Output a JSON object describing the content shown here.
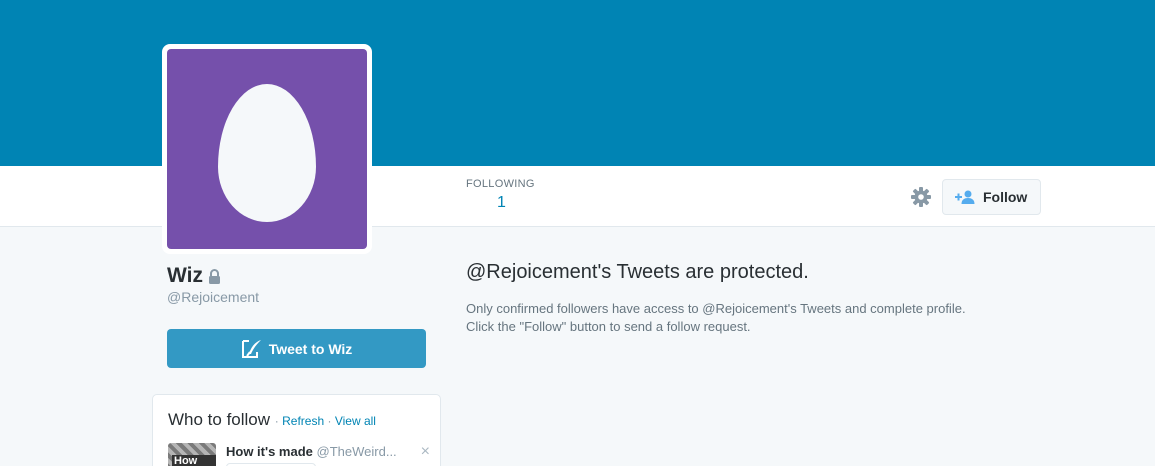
{
  "profile": {
    "name": "Wiz",
    "handle": "@Rejoicement"
  },
  "stats": {
    "following_label": "FOLLOWING",
    "following_value": "1"
  },
  "actions": {
    "follow_label": "Follow",
    "tweet_to_label": "Tweet to Wiz"
  },
  "protected": {
    "title": "@Rejoicement's Tweets are protected.",
    "line1": "Only confirmed followers have access to @Rejoicement's Tweets and complete profile.",
    "line2": "Click the \"Follow\" button to send a follow request."
  },
  "who_to_follow": {
    "title": "Who to follow",
    "separator": "·",
    "refresh_label": "Refresh",
    "view_all_label": "View all",
    "items": [
      {
        "name": "How it's made",
        "handle": "@TheWeird...",
        "thumb_text": "How It's",
        "close": "×"
      }
    ]
  },
  "colors": {
    "header": "#0084b4",
    "avatar_bg": "#7550ab",
    "tweet_button": "#3399c4",
    "link": "#0084b4"
  },
  "icons": [
    "gear-icon",
    "add-user-icon",
    "lock-icon",
    "compose-icon",
    "egg-avatar-icon",
    "close-icon"
  ]
}
